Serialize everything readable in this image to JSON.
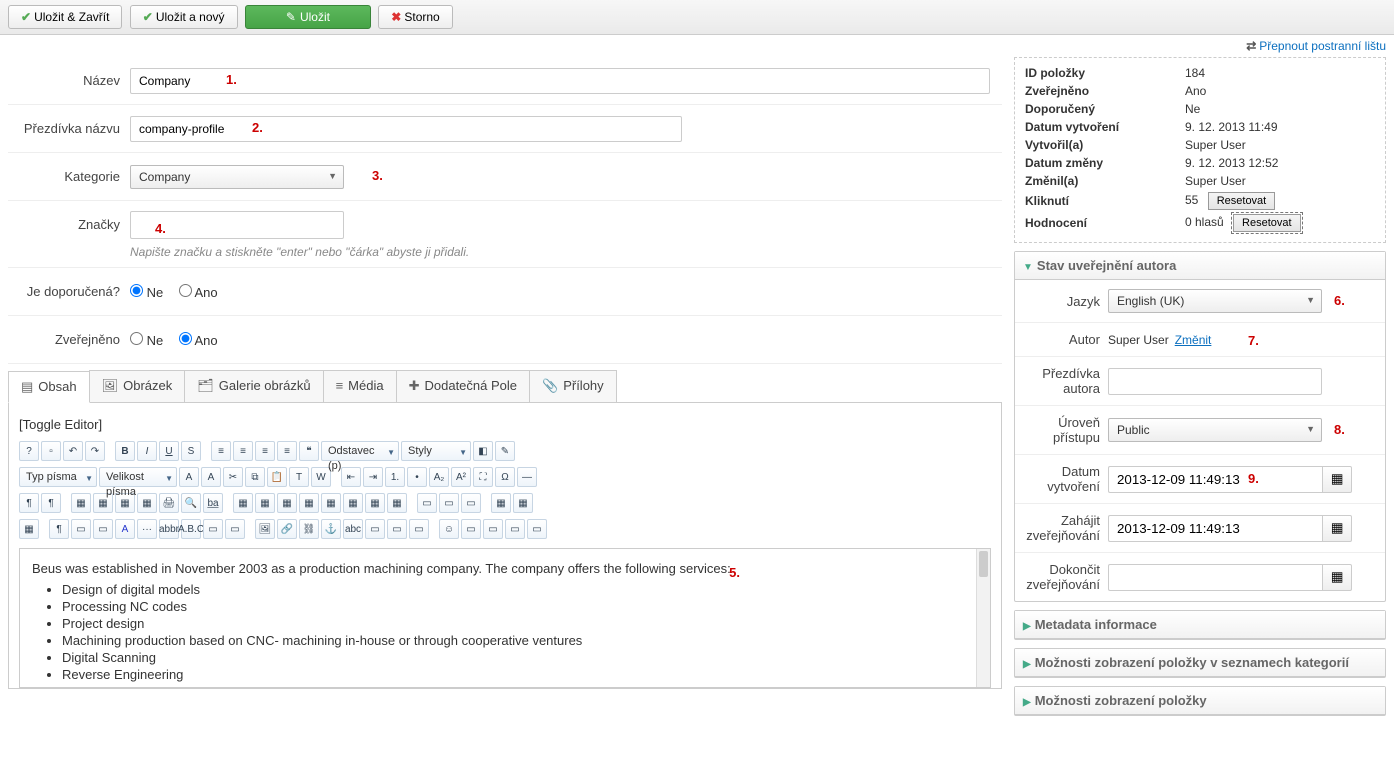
{
  "toolbar": {
    "save_close": "Uložit & Zavřít",
    "save_new": "Uložit a nový",
    "save": "Uložit",
    "cancel": "Storno"
  },
  "toggle_sidebar": "Přepnout postranní lištu",
  "form": {
    "name_label": "Název",
    "name_value": "Company",
    "alias_label": "Přezdívka názvu",
    "alias_value": "company-profile",
    "category_label": "Kategorie",
    "category_value": "Company",
    "tags_label": "Značky",
    "tags_note": "Napište značku a stiskněte \"enter\" nebo \"čárka\" abyste ji přidali.",
    "featured_label": "Je doporučená?",
    "published_label": "Zveřejněno",
    "opt_ne": "Ne",
    "opt_ano": "Ano"
  },
  "annotations": {
    "a1": "1.",
    "a2": "2.",
    "a3": "3.",
    "a4": "4.",
    "a5": "5.",
    "a6": "6.",
    "a7": "7.",
    "a8": "8.",
    "a9": "9."
  },
  "tabs": {
    "content": "Obsah",
    "image": "Obrázek",
    "gallery": "Galerie obrázků",
    "media": "Média",
    "extra": "Dodatečná Pole",
    "attach": "Přílohy"
  },
  "editor": {
    "toggle": "[Toggle Editor]",
    "paragraph": "Odstavec (p)",
    "styles": "Styly",
    "font_family": "Typ písma",
    "font_size": "Velikost písma",
    "intro": "Beus was established in November 2003 as a production machining company. The company offers the following services:",
    "bullets": [
      "Design of digital models",
      "Processing NC codes",
      "Project design",
      "Machining production based on CNC- machining in-house or through cooperative ventures",
      "Digital Scanning",
      "Reverse Engineering"
    ]
  },
  "info": {
    "id_label": "ID položky",
    "id_val": "184",
    "published_label": "Zveřejněno",
    "published_val": "Ano",
    "featured_label": "Doporučený",
    "featured_val": "Ne",
    "created_label": "Datum vytvoření",
    "created_val": "9. 12. 2013 11:49",
    "createdby_label": "Vytvořil(a)",
    "createdby_val": "Super User",
    "modified_label": "Datum změny",
    "modified_val": "9. 12. 2013 12:52",
    "modifiedby_label": "Změnil(a)",
    "modifiedby_val": "Super User",
    "hits_label": "Kliknutí",
    "hits_val": "55",
    "rating_label": "Hodnocení",
    "rating_val": "0 hlasů",
    "reset": "Resetovat"
  },
  "author_panel": {
    "header": "Stav uveřejnění autora",
    "lang_label": "Jazyk",
    "lang_val": "English (UK)",
    "author_label": "Autor",
    "author_val": "Super User",
    "change": "Změnit",
    "alias_label": "Přezdívka autora",
    "access_label": "Úroveň přístupu",
    "access_val": "Public",
    "created_label": "Datum vytvoření",
    "created_val": "2013-12-09 11:49:13",
    "start_label": "Zahájit zveřejňování",
    "start_val": "2013-12-09 11:49:13",
    "end_label": "Dokončit zveřejňování",
    "end_val": ""
  },
  "panels": {
    "metadata": "Metadata informace",
    "listing": "Možnosti zobrazení položky v seznamech kategorií",
    "item": "Možnosti zobrazení položky"
  }
}
